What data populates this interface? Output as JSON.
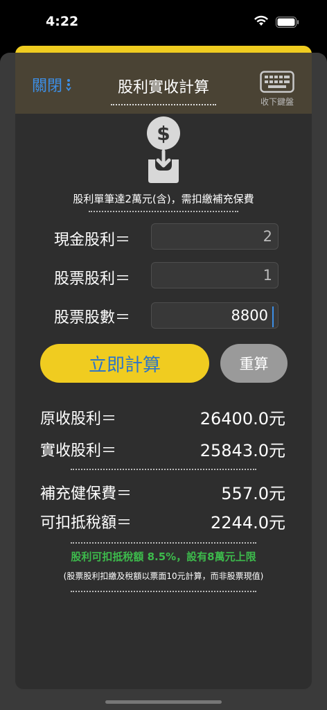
{
  "status": {
    "time": "4:22"
  },
  "header": {
    "close_label": "關閉",
    "title": "股利實收計算",
    "keyboard_label": "收下鍵盤"
  },
  "notice": "股利單筆達2萬元(含)，需扣繳補充保費",
  "inputs": {
    "cash_dividend": {
      "label": "現金股利＝",
      "value": "2"
    },
    "stock_dividend": {
      "label": "股票股利＝",
      "value": "1"
    },
    "shares": {
      "label": "股票股數＝",
      "value": "8800"
    }
  },
  "buttons": {
    "calculate": "立即計算",
    "reset": "重算"
  },
  "results": {
    "original": {
      "label": "原收股利＝",
      "value": "26400.0元"
    },
    "actual": {
      "label": "實收股利＝",
      "value": "25843.0元"
    },
    "premium": {
      "label": "補充健保費＝",
      "value": "557.0元"
    },
    "deductible": {
      "label": "可扣抵稅額＝",
      "value": "2244.0元"
    }
  },
  "notes": {
    "green": "股利可扣抵稅額 8.5%，設有8萬元上限",
    "small": "(股票股利扣繳及稅額以票面10元計算，而非股票現值)"
  },
  "colors": {
    "accent_yellow": "#f0cc20",
    "link_blue": "#3d8fe6",
    "note_green": "#3dbb4c"
  }
}
